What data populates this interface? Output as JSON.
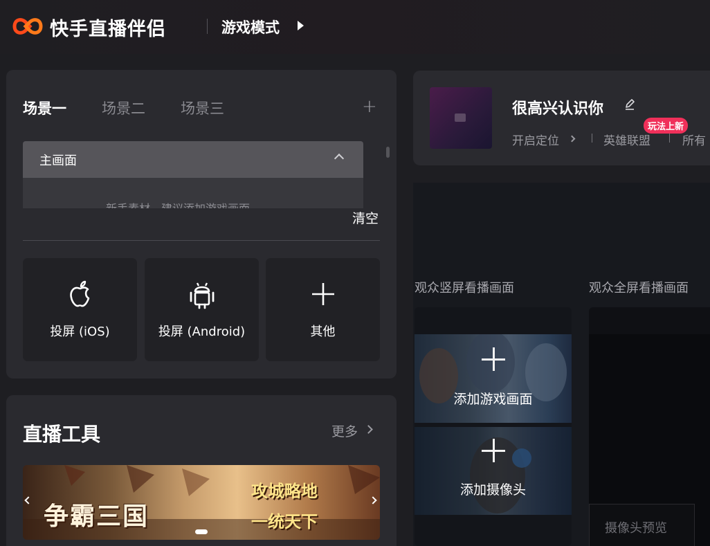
{
  "header": {
    "app_name": "快手直播伴侣",
    "mode": "游戏模式",
    "brand_color": "#ff4a1a"
  },
  "scenes": {
    "tabs": [
      "场景一",
      "场景二",
      "场景三"
    ],
    "active_tab": "场景一",
    "add_icon": "plus-icon",
    "main_scene_label": "主画面",
    "hint": "新手素材，建议添加游戏画面",
    "clear_label": "清空",
    "sources": [
      {
        "label": "投屏 (iOS)",
        "icon": "apple-icon"
      },
      {
        "label": "投屏 (Android)",
        "icon": "android-icon"
      },
      {
        "label": "其他",
        "icon": "plus-icon"
      }
    ]
  },
  "tools": {
    "title": "直播工具",
    "more_label": "更多",
    "banner": {
      "title": "争霸三国",
      "slogan_1": "攻城略地",
      "slogan_2": "一统天下"
    }
  },
  "room": {
    "title": "很高兴认识你",
    "location": "开启定位",
    "game": "英雄联盟",
    "badge": "玩法上新",
    "audience": "所有",
    "badge_color": "#f0305a"
  },
  "preview": {
    "portrait_label": "观众竖屏看播画面",
    "landscape_label": "观众全屏看播画面",
    "add_game_label": "添加游戏画面",
    "add_camera_label": "添加摄像头",
    "camera_preview_label": "摄像头预览"
  }
}
